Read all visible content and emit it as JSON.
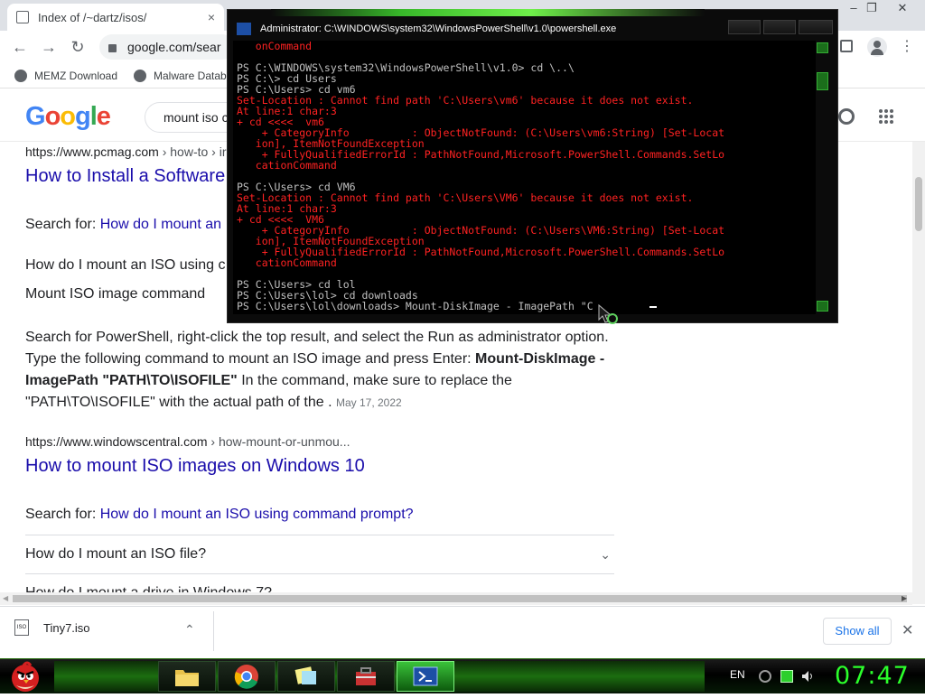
{
  "browser": {
    "tab_title": "Index of /~dartz/isos/",
    "tab_close": "×",
    "omnibox_text": "google.com/sear",
    "bookmarks": [
      "MEMZ Download",
      "Malware Datab"
    ],
    "window_controls": [
      "–",
      "❐",
      "✕"
    ]
  },
  "google": {
    "logo": "Google",
    "search_value": "mount iso c"
  },
  "results": [
    {
      "url": "https://www.pcmag.com",
      "crumb": " › how-to › ir",
      "title": "How to Install a Software",
      "search_for_prefix": "Search for: ",
      "search_for_link": "How do I mount an",
      "text1": "How do I mount an ISO using c",
      "text2": "Mount ISO image command",
      "snippet1": "Search for PowerShell, right-click the top result, and select the Run as administrator option.",
      "snippet2_plain": "Type the following command to mount an ISO image and press Enter: ",
      "snippet2_bold": "Mount-DiskImage -",
      "snippet3_bold": "ImagePath \"PATH\\TO\\ISOFILE\"",
      "snippet3_plain": " In the command, make sure to replace the",
      "snippet4": "\"PATH\\TO\\ISOFILE\" with the actual path of the .",
      "date": "May 17, 2022"
    },
    {
      "url": "https://www.windowscentral.com",
      "crumb": " › how-mount-or-unmou...",
      "title": "How to mount ISO images on Windows 10",
      "search_for_prefix": "Search for: ",
      "search_for_link": "How do I mount an ISO using command prompt?"
    }
  ],
  "faq": [
    "How do I mount an ISO file?",
    "How do I mount a drive in Windows 7?"
  ],
  "downloads": {
    "file": "Tiny7.iso",
    "show_all": "Show all"
  },
  "powershell": {
    "title": "Administrator: C:\\WINDOWS\\system32\\WindowsPowerShell\\v1.0\\powershell.exe",
    "lines": [
      {
        "text": "   onCommand",
        "err": true
      },
      {
        "text": "",
        "err": false
      },
      {
        "text": "PS C:\\WINDOWS\\system32\\WindowsPowerShell\\v1.0> cd \\..\\",
        "err": false
      },
      {
        "text": "PS C:\\> cd Users",
        "err": false
      },
      {
        "text": "PS C:\\Users> cd vm6",
        "err": false
      },
      {
        "text": "Set-Location : Cannot find path 'C:\\Users\\vm6' because it does not exist.",
        "err": true
      },
      {
        "text": "At line:1 char:3",
        "err": true
      },
      {
        "text": "+ cd <<<<  vm6",
        "err": true
      },
      {
        "text": "    + CategoryInfo          : ObjectNotFound: (C:\\Users\\vm6:String) [Set-Locat",
        "err": true
      },
      {
        "text": "   ion], ItemNotFoundException",
        "err": true
      },
      {
        "text": "    + FullyQualifiedErrorId : PathNotFound,Microsoft.PowerShell.Commands.SetLo",
        "err": true
      },
      {
        "text": "   cationCommand",
        "err": true
      },
      {
        "text": "",
        "err": false
      },
      {
        "text": "PS C:\\Users> cd VM6",
        "err": false
      },
      {
        "text": "Set-Location : Cannot find path 'C:\\Users\\VM6' because it does not exist.",
        "err": true
      },
      {
        "text": "At line:1 char:3",
        "err": true
      },
      {
        "text": "+ cd <<<<  VM6",
        "err": true
      },
      {
        "text": "    + CategoryInfo          : ObjectNotFound: (C:\\Users\\VM6:String) [Set-Locat",
        "err": true
      },
      {
        "text": "   ion], ItemNotFoundException",
        "err": true
      },
      {
        "text": "    + FullyQualifiedErrorId : PathNotFound,Microsoft.PowerShell.Commands.SetLo",
        "err": true
      },
      {
        "text": "   cationCommand",
        "err": true
      },
      {
        "text": "",
        "err": false
      },
      {
        "text": "PS C:\\Users> cd lol",
        "err": false
      },
      {
        "text": "PS C:\\Users\\lol> cd downloads",
        "err": false
      },
      {
        "text": "PS C:\\Users\\lol\\downloads> Mount-DiskImage - ImagePath \"C",
        "err": false
      }
    ]
  },
  "taskbar": {
    "lang": "EN",
    "clock": "07:47"
  },
  "colors": {
    "link": "#1a0dab",
    "ps_error": "#ff2222",
    "ps_text": "#c0c0c0",
    "clock": "#2bff2b"
  }
}
